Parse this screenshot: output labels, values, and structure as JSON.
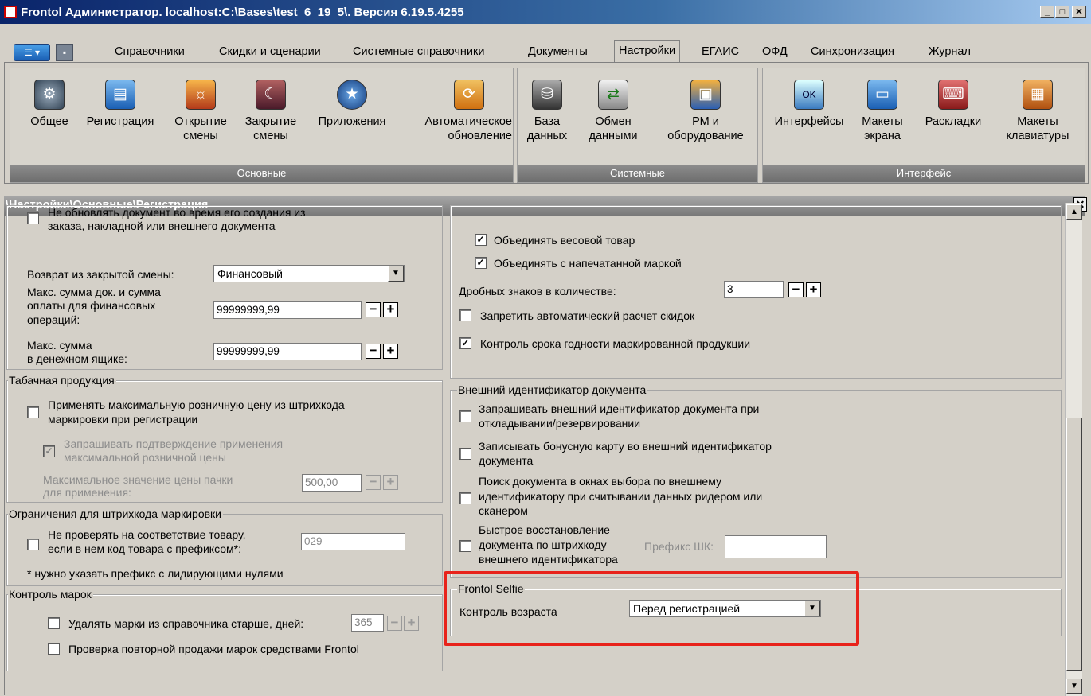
{
  "window": {
    "title": "Frontol Администратор. localhost:C:\\Bases\\test_6_19_5\\. Версия 6.19.5.4255"
  },
  "menu": {
    "tabs": [
      "Справочники",
      "Скидки и сценарии",
      "Системные справочники",
      "Документы",
      "Настройки",
      "ЕГАИС",
      "ОФД",
      "Синхронизация",
      "Журнал"
    ],
    "active_tab": "Настройки"
  },
  "ribbon": {
    "groups": [
      {
        "name": "Основные",
        "buttons": [
          {
            "label1": "Общее",
            "label2": ""
          },
          {
            "label1": "Регистрация",
            "label2": ""
          },
          {
            "label1": "Открытие",
            "label2": "смены"
          },
          {
            "label1": "Закрытие",
            "label2": "смены"
          },
          {
            "label1": "Приложения",
            "label2": ""
          },
          {
            "label1": "Автоматическое",
            "label2": "обновление"
          }
        ]
      },
      {
        "name": "Системные",
        "buttons": [
          {
            "label1": "База",
            "label2": "данных"
          },
          {
            "label1": "Обмен",
            "label2": "данными"
          },
          {
            "label1": "РМ и",
            "label2": "оборудование"
          }
        ]
      },
      {
        "name": "Интерфейс",
        "buttons": [
          {
            "label1": "Интерфейсы",
            "label2": ""
          },
          {
            "label1": "Макеты",
            "label2": "экрана"
          },
          {
            "label1": "Раскладки",
            "label2": ""
          },
          {
            "label1": "Макеты",
            "label2": "клавиатуры"
          }
        ]
      }
    ]
  },
  "panel": {
    "path": "\\Настройки\\Основные\\Регистрация"
  },
  "left": {
    "no_update_l1": "Не обновлять документ во время его создания из",
    "no_update_l2": "заказа, накладной или внешнего документа",
    "return_label": "Возврат из закрытой смены:",
    "return_value": "Финансовый",
    "max_doc_l1": "Макс. сумма док. и сумма",
    "max_doc_l2": "оплаты для финансовых",
    "max_doc_l3": "операций:",
    "max_doc_value": "99999999,99",
    "max_cash_l1": "Макс. сумма",
    "max_cash_l2": "в денежном ящике:",
    "max_cash_value": "99999999,99",
    "tobacco_title": "Табачная продукция",
    "tob_apply_l1": "Применять максимальную розничную цену из штрихкода",
    "tob_apply_l2": "маркировки при регистрации",
    "tob_confirm_l1": "Запрашивать подтверждение применения",
    "tob_confirm_l2": "максимальной розничной цены",
    "tob_max_l1": "Максимальное значение цены пачки",
    "tob_max_l2": "для применения:",
    "tob_max_value": "500,00",
    "barcode_title": "Ограничения для штрихкода маркировки",
    "bc_check_l1": "Не проверять на соответствие товару,",
    "bc_check_l2": "если в нем код товара с префиксом*:",
    "bc_prefix": "029",
    "bc_note": "* нужно указать префикс с лидирующими нулями",
    "marks_title": "Контроль марок",
    "marks_delete": "Удалять марки из справочника старше, дней:",
    "marks_days": "365",
    "marks_repeat": "Проверка повторной продажи марок средствами Frontol"
  },
  "right": {
    "merge_weight": "Объединять весовой товар",
    "merge_printed": "Объединять с напечатанной маркой",
    "fraction_label": "Дробных знаков в количестве:",
    "fraction_value": "3",
    "no_auto_discount": "Запретить автоматический расчет скидок",
    "expiry_control": "Контроль срока годности маркированной продукции",
    "ext_title": "Внешний идентификатор документа",
    "ext_ask_l1": "Запрашивать внешний идентификатор документа при",
    "ext_ask_l2": "откладывании/резервировании",
    "ext_bonus_l1": "Записывать бонусную карту во внешний идентификатор",
    "ext_bonus_l2": "документа",
    "ext_search_l1": "Поиск документа в окнах выбора по внешнему",
    "ext_search_l2": "идентификатору при считывании данных ридером или",
    "ext_search_l3": "сканером",
    "ext_fast_l1": "Быстрое восстановление",
    "ext_fast_l2": "документа по штрихкоду",
    "ext_fast_l3": "внешнего идентификатора",
    "prefix_label": "Префикс ШК:",
    "prefix_value": "",
    "selfie_title": "Frontol Selfie",
    "age_label": "Контроль возраста",
    "age_value": "Перед регистрацией"
  },
  "colors": {
    "highlight": "#e8231b",
    "title_start": "#0a246a"
  }
}
